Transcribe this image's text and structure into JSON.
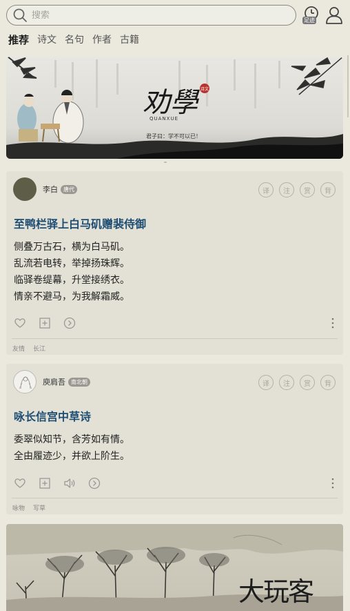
{
  "search": {
    "placeholder": "搜索"
  },
  "header": {
    "footprint_badge": "足迹"
  },
  "tabs": [
    {
      "label": "推荐",
      "active": true
    },
    {
      "label": "诗文"
    },
    {
      "label": "名句"
    },
    {
      "label": "作者"
    },
    {
      "label": "古籍"
    }
  ],
  "banner": {
    "title": "劝學",
    "seal": "诗文",
    "title_pinyin": "QUANXUE",
    "subtitle": "君子曰：学不可以已！"
  },
  "action_labels": {
    "translate": "译",
    "annotate": "注",
    "appreciate": "赏",
    "background": "背"
  },
  "poems": [
    {
      "author": "李白",
      "dynasty": "唐代",
      "title": "至鸭栏驿上白马矶赠裴侍御",
      "lines": [
        "侧叠万古石，横为白马矶。",
        "乱流若电转，举掉扬珠辉。",
        "临驿卷缇幕，升堂接绣衣。",
        "情亲不避马，为我解霜威。"
      ],
      "tags": [
        "友情",
        "长江"
      ]
    },
    {
      "author": "庾肩吾",
      "dynasty": "南北朝",
      "title": "咏长信宫中草诗",
      "lines": [
        "委翠似知节，含芳如有情。",
        "全由履迹少，并欲上阶生。"
      ],
      "tags": [
        "咏物",
        "写草"
      ]
    }
  ],
  "watermark": "大玩客",
  "colors": {
    "background": "#ebe9de",
    "card": "#e3e1d5",
    "title": "#1e4d73"
  }
}
